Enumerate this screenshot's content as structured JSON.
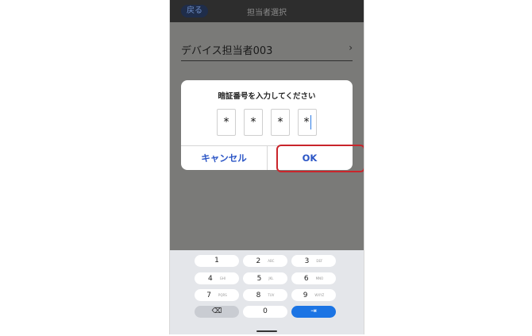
{
  "topbar": {
    "back_label": "戻る",
    "title": "担当者選択"
  },
  "list": {
    "item_label": "デバイス担当者003",
    "chevron": "›"
  },
  "dialog": {
    "title": "暗証番号を入力してください",
    "pin": [
      "*",
      "*",
      "*",
      "*"
    ],
    "cancel_label": "キャンセル",
    "ok_label": "OK"
  },
  "keyboard": {
    "keys": [
      {
        "main": "1",
        "sub": ""
      },
      {
        "main": "2",
        "sub": "ABC"
      },
      {
        "main": "3",
        "sub": "DEF"
      },
      {
        "main": "4",
        "sub": "GHI"
      },
      {
        "main": "5",
        "sub": "JKL"
      },
      {
        "main": "6",
        "sub": "MNO"
      },
      {
        "main": "7",
        "sub": "PQRS"
      },
      {
        "main": "8",
        "sub": "TUV"
      },
      {
        "main": "9",
        "sub": "WXYZ"
      },
      {
        "main": "⌫",
        "sub": ""
      },
      {
        "main": "0",
        "sub": ""
      },
      {
        "main": "⇥",
        "sub": ""
      }
    ]
  },
  "colors": {
    "accent": "#2c56c6",
    "highlight": "#c9252b",
    "enter_key": "#1b74e4"
  }
}
